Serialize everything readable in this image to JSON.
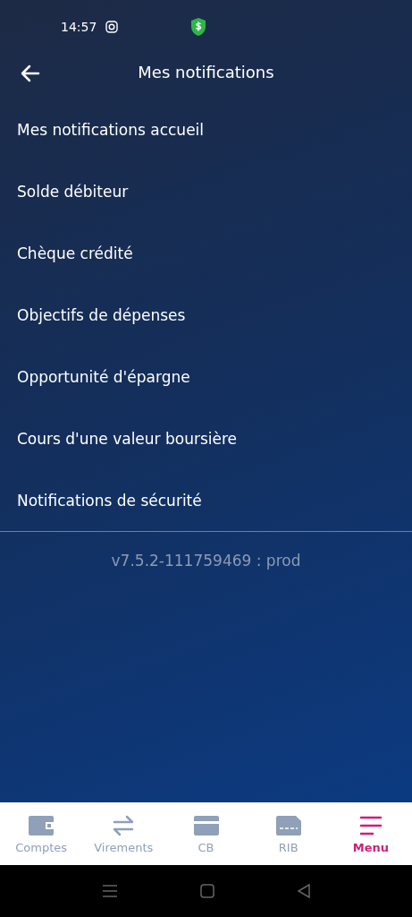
{
  "status_bar": {
    "time": "14:57"
  },
  "header": {
    "title": "Mes notifications"
  },
  "items": [
    {
      "label": "Mes notifications accueil"
    },
    {
      "label": "Solde débiteur"
    },
    {
      "label": "Chèque crédité"
    },
    {
      "label": "Objectifs de dépenses"
    },
    {
      "label": "Opportunité d'épargne"
    },
    {
      "label": "Cours d'une valeur boursière"
    },
    {
      "label": "Notifications de sécurité"
    }
  ],
  "version": "v7.5.2-111759469 : prod",
  "bottom_nav": [
    {
      "kind": "wallet",
      "label": "Comptes",
      "selected": false
    },
    {
      "kind": "transfer",
      "label": "Virements",
      "selected": false
    },
    {
      "kind": "card",
      "label": "CB",
      "selected": false
    },
    {
      "kind": "rib",
      "label": "RIB",
      "selected": false
    },
    {
      "kind": "menu",
      "label": "Menu",
      "selected": true
    }
  ]
}
